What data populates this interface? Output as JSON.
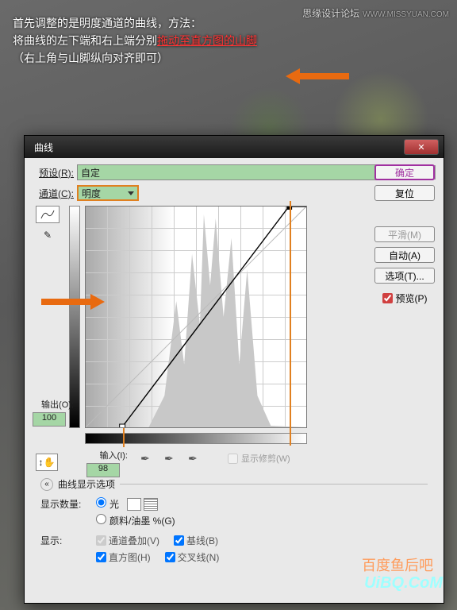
{
  "tutorial": {
    "line1": "首先调整的是明度通道的曲线，方法：",
    "line2a": "将曲线的左下端和右上端分别",
    "line2b": "拖动至直方图的山脚",
    "line3": "（右上角与山脚纵向对齐即可）"
  },
  "brand": {
    "name": "思缘设计论坛",
    "url": "WWW.MISSYUAN.COM"
  },
  "watermark": {
    "top": "百度鱼后吧",
    "bottom": "UiBQ.CoM"
  },
  "dialog": {
    "title": "曲线",
    "preset_label": "预设(R):",
    "preset_value": "自定",
    "channel_label": "通道(C):",
    "channel_value": "明度",
    "buttons": {
      "ok": "确定",
      "reset": "复位",
      "smooth": "平滑(M)",
      "auto": "自动(A)",
      "options": "选项(T)..."
    },
    "preview_label": "预览(P)",
    "output_label": "输出(O):",
    "output_value": "100",
    "input_label": "输入(I):",
    "input_value": "98",
    "showclip": "显示修剪(W)",
    "disp_header": "曲线显示选项",
    "amount_label": "显示数量:",
    "radio_light": "光",
    "radio_ink": "颜料/油墨 %(G)",
    "show_label": "显示:",
    "cb_overlay": "通道叠加(V)",
    "cb_baseline": "基线(B)",
    "cb_hist": "直方图(H)",
    "cb_intersect": "交叉线(N)"
  },
  "chart_data": {
    "type": "line",
    "title": "明度曲线",
    "xlabel": "输入",
    "ylabel": "输出",
    "xlim": [
      0,
      255
    ],
    "ylim": [
      0,
      255
    ],
    "series": [
      {
        "name": "curve",
        "x": [
          0,
          98,
          235,
          255
        ],
        "y": [
          0,
          100,
          255,
          255
        ]
      }
    ],
    "markers": [
      {
        "x": 98,
        "y": 100,
        "label": "active-point"
      }
    ],
    "histogram_peaks_x": [
      120,
      135,
      150,
      160,
      170,
      180,
      190,
      200
    ]
  }
}
